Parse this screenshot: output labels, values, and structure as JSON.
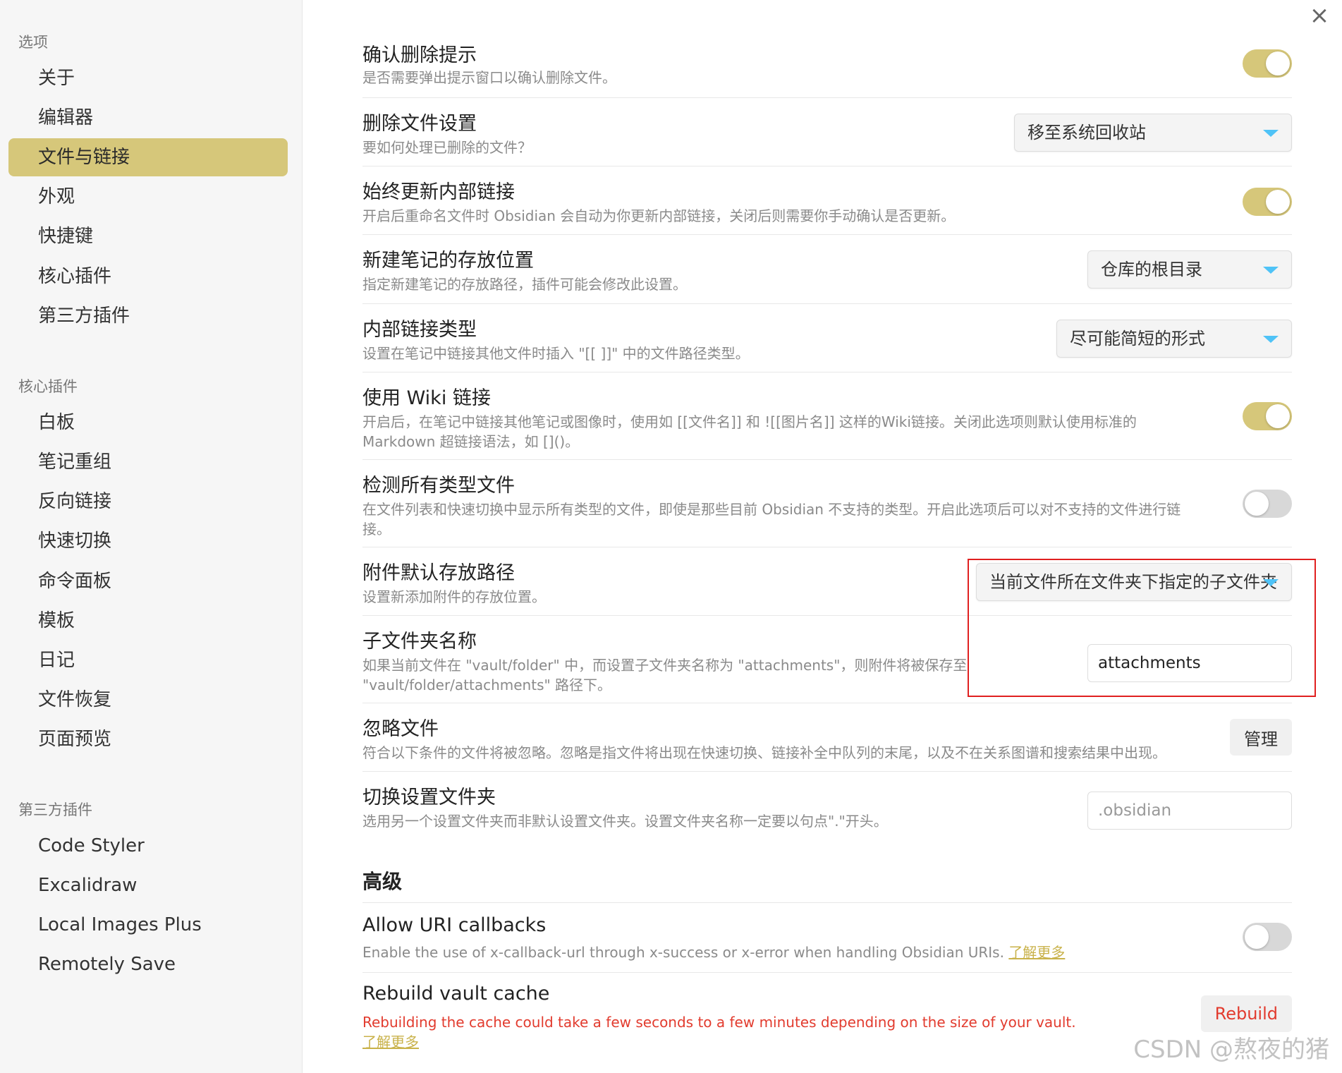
{
  "sidebar": {
    "groups": [
      {
        "title": "选项",
        "items": [
          "关于",
          "编辑器",
          "文件与链接",
          "外观",
          "快捷键",
          "核心插件",
          "第三方插件"
        ]
      },
      {
        "title": "核心插件",
        "items": [
          "白板",
          "笔记重组",
          "反向链接",
          "快速切换",
          "命令面板",
          "模板",
          "日记",
          "文件恢复",
          "页面预览"
        ]
      },
      {
        "title": "第三方插件",
        "items": [
          "Code Styler",
          "Excalidraw",
          "Local Images Plus",
          "Remotely Save"
        ]
      }
    ],
    "active_item": "文件与链接"
  },
  "close_icon": "×",
  "settings": {
    "confirm_delete": {
      "title": "确认删除提示",
      "desc": "是否需要弹出提示窗口以确认删除文件。",
      "toggle": "on"
    },
    "delete_file": {
      "title": "删除文件设置",
      "desc": "要如何处理已删除的文件？",
      "value": "移至系统回收站"
    },
    "auto_update_links": {
      "title": "始终更新内部链接",
      "desc": "开启后重命名文件时 Obsidian 会自动为你更新内部链接，关闭后则需要你手动确认是否更新。",
      "toggle": "on"
    },
    "new_note_location": {
      "title": "新建笔记的存放位置",
      "desc": "指定新建笔记的存放路径，插件可能会修改此设置。",
      "value": "仓库的根目录"
    },
    "link_type": {
      "title": "内部链接类型",
      "desc": "设置在笔记中链接其他文件时插入 \"[[ ]]\" 中的文件路径类型。",
      "value": "尽可能简短的形式"
    },
    "wiki_links": {
      "title": "使用 Wiki 链接",
      "desc_line1": "开启后，在笔记中链接其他笔记或图像时，使用如 [[文件名]] 和 ![[图片名]] 这样的Wiki链接。关闭此选项则默认使用标准的",
      "desc_line2": "Markdown 超链接语法，如 []()。",
      "toggle": "on"
    },
    "detect_all": {
      "title": "检测所有类型文件",
      "desc_line1": "在文件列表和快速切换中显示所有类型的文件，即使是那些目前 Obsidian 不支持的类型。开启此选项后可以对不支持的文件进行链",
      "desc_line2": "接。",
      "toggle": "off"
    },
    "attachment_path": {
      "title": "附件默认存放路径",
      "desc": "设置新添加附件的存放位置。",
      "value": "当前文件所在文件夹下指定的子文件夹"
    },
    "subfolder_name": {
      "title": "子文件夹名称",
      "desc_line1": "如果当前文件在 \"vault/folder\" 中，而设置子文件夹名称为 \"attachments\"，则附件将被保存至",
      "desc_line2": "\"vault/folder/attachments\" 路径下。",
      "value": "attachments"
    },
    "ignore_files": {
      "title": "忽略文件",
      "desc": "符合以下条件的文件将被忽略。忽略是指文件将出现在快速切换、链接补全中队列的末尾，以及不在关系图谱和搜索结果中出现。",
      "button": "管理"
    },
    "config_folder": {
      "title": "切换设置文件夹",
      "desc": "选用另一个设置文件夹而非默认设置文件夹。设置文件夹名称一定要以句点\".\"开头。",
      "placeholder": ".obsidian"
    }
  },
  "advanced": {
    "heading": "高级",
    "uri_callbacks": {
      "title": "Allow URI callbacks",
      "desc": "Enable the use of x-callback-url through x-success or x-error when handling Obsidian URIs.",
      "link": "了解更多",
      "toggle": "off"
    },
    "rebuild_cache": {
      "title": "Rebuild vault cache",
      "desc": "Rebuilding the cache could take a few seconds to a few minutes depending on the size of your vault.",
      "link": "了解更多",
      "button": "Rebuild"
    }
  },
  "watermark": "CSDN @熬夜的猪",
  "colors": {
    "accent": "#d6c77a",
    "warn": "#e23b2e",
    "caret": "#4fc3f7",
    "highlight": "#e02020"
  }
}
